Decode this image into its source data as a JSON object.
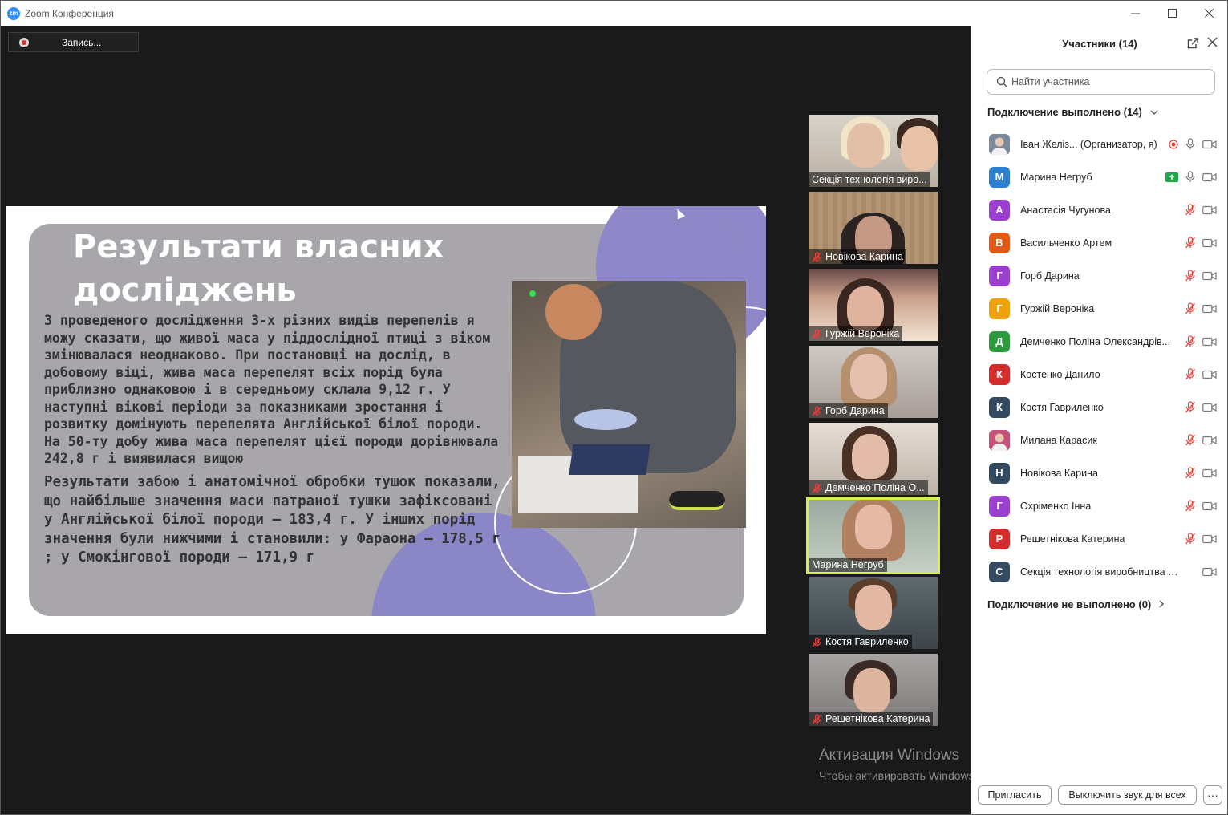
{
  "window": {
    "title": "Zoom Конференция",
    "logo": "zm"
  },
  "recording": {
    "label": "Запись..."
  },
  "slide": {
    "title": "Результати власних досліджень",
    "paragraph1": "З проведеного дослідження 3-х різних видів перепелів я можу сказати, що живої маса у піддослідної птиці з віком змінювалася неоднаково. При постановці на дослід, в добовому віці, жива маса перепелят всіх порід була приблизно однаковою і в середньому склала 9,12 г. У наступні вікові періоди за показниками зростання і розвитку домінують перепелята Англійської білої породи. На 50-ту добу жива маса перепелят цієї породи дорівнювала 242,8 г і виявилася вищою",
    "paragraph2": "Результати забою і анатомічної обробки тушок показали, що найбільше значення маси патраної тушки зафіксовані у Англійської білої породи – 183,4 г. У інших порід значення були нижчими і становили: у Фараона – 178,5 г ; у Смокінгової породи – 171,9 г"
  },
  "thumbnails": [
    {
      "label": "Секція технологія виро...",
      "muted": false,
      "active": false
    },
    {
      "label": "Новікова Карина",
      "muted": true,
      "active": false
    },
    {
      "label": "Гуржій Вероніка",
      "muted": true,
      "active": false
    },
    {
      "label": "Горб Дарина",
      "muted": true,
      "active": false
    },
    {
      "label": "Демченко Поліна  О...",
      "muted": true,
      "active": false
    },
    {
      "label": "Марина Негруб",
      "muted": false,
      "active": true
    },
    {
      "label": "Костя  Гавриленко",
      "muted": true,
      "active": false
    },
    {
      "label": "Решетнікова Катерина",
      "muted": true,
      "active": false
    }
  ],
  "watermark": {
    "line1": "Активация Windows",
    "line2": "Чтобы активировать Windows, перейдите в раздел \"Параметры\"."
  },
  "participants_panel": {
    "title": "Участники (14)",
    "search_placeholder": "Найти участника",
    "connected_header": "Подключение выполнено (14)",
    "not_connected_header": "Подключение не выполнено (0)",
    "participants": [
      {
        "initial": "",
        "color": "#7a8a9a",
        "photo": true,
        "name": "Іван Желіз... (Организатор, я)",
        "mic": "on",
        "recording": true,
        "camera": "off"
      },
      {
        "initial": "М",
        "color": "#2f7fd0",
        "photo": false,
        "name": "Марина Негруб",
        "mic": "on",
        "sharing": true,
        "camera": "off"
      },
      {
        "initial": "А",
        "color": "#9b3fcf",
        "photo": false,
        "name": "Анастасія Чугунова",
        "mic": "muted",
        "camera": "off"
      },
      {
        "initial": "В",
        "color": "#e05a16",
        "photo": false,
        "name": "Васильченко Артем",
        "mic": "muted",
        "camera": "off"
      },
      {
        "initial": "Г",
        "color": "#9b3fcf",
        "photo": false,
        "name": "Горб Дарина",
        "mic": "muted",
        "camera": "off"
      },
      {
        "initial": "Г",
        "color": "#f0a20c",
        "photo": false,
        "name": "Гуржій Вероніка",
        "mic": "muted",
        "camera": "off"
      },
      {
        "initial": "Д",
        "color": "#2a9a3c",
        "photo": false,
        "name": "Демченко Поліна  Олександрів...",
        "mic": "muted",
        "camera": "off"
      },
      {
        "initial": "К",
        "color": "#d32d2d",
        "photo": false,
        "name": "Костенко Данило",
        "mic": "muted",
        "camera": "off"
      },
      {
        "initial": "К",
        "color": "#344a60",
        "photo": false,
        "name": "Костя  Гавриленко",
        "mic": "muted",
        "camera": "off"
      },
      {
        "initial": "",
        "color": "#c4527a",
        "photo": true,
        "name": "Милана Карасик",
        "mic": "muted",
        "camera": "off"
      },
      {
        "initial": "Н",
        "color": "#344a60",
        "photo": false,
        "name": "Новікова Карина",
        "mic": "muted",
        "camera": "off"
      },
      {
        "initial": "Г",
        "color": "#9b3fcf",
        "photo": false,
        "name": "Охріменко Інна",
        "mic": "muted",
        "camera": "off"
      },
      {
        "initial": "Р",
        "color": "#d32d2d",
        "photo": false,
        "name": "Решетнікова Катерина",
        "mic": "muted",
        "camera": "off"
      },
      {
        "initial": "С",
        "color": "#344a60",
        "photo": false,
        "name": "Секція технологія виробництва про...",
        "mic": "none",
        "camera": "off"
      }
    ]
  },
  "buttons": {
    "invite": "Пригласить",
    "mute_all": "Выключить звук для всех",
    "more": "···"
  }
}
